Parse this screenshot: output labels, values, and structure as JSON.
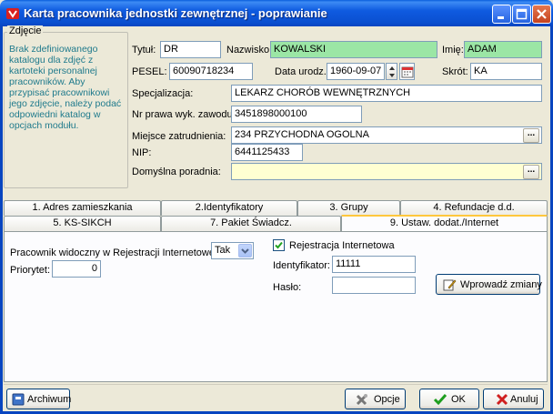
{
  "window": {
    "title": "Karta pracownika jednostki zewnętrznej - poprawianie",
    "colors": {
      "titlebar": "#0a4fd0",
      "field_green": "#9be6a5",
      "field_yellow": "#ffffd2",
      "photo_text": "#1f7a8c"
    }
  },
  "photo": {
    "legend": "Zdjęcie",
    "message": "Brak zdefiniowanego katalogu dla zdjęć z kartoteki personalnej pracowników. Aby przypisać pracownikowi jego zdjęcie, należy podać odpowiedni katalog w opcjach modułu."
  },
  "form": {
    "tytul": {
      "label": "Tytuł:",
      "value": "DR"
    },
    "nazwisko": {
      "label": "Nazwisko:",
      "value": "KOWALSKI"
    },
    "imie": {
      "label": "Imię:",
      "value": "ADAM"
    },
    "pesel": {
      "label": "PESEL:",
      "value": "60090718234"
    },
    "data_urodz": {
      "label": "Data urodz.:",
      "value": "1960-09-07"
    },
    "skrot": {
      "label": "Skrót:",
      "value": "KA"
    },
    "specjalizacja": {
      "label": "Specjalizacja:",
      "value": "LEKARZ CHORÓB WEWNĘTRZNYCH"
    },
    "nr_prawa": {
      "label": "Nr prawa wyk. zawodu:",
      "value": "3451898000100"
    },
    "miejsce": {
      "label": "Miejsce zatrudnienia:",
      "value": "234 PRZYCHODNA OGOLNA"
    },
    "nip": {
      "label": "NIP:",
      "value": "6441125433"
    },
    "poradnia": {
      "label": "Domyślna poradnia:",
      "value": ""
    },
    "dots": "..."
  },
  "tabs": {
    "row1": [
      "1. Adres zamieszkania",
      "2.Identyfikatory",
      "3. Grupy",
      "4. Refundacje d.d."
    ],
    "row2": [
      "5. KS-SIKCH",
      "7. Pakiet Świadcz.",
      "9. Ustaw. dodat./Internet"
    ],
    "active": "9. Ustaw. dodat./Internet"
  },
  "panel": {
    "widoczny_label": "Pracownik widoczny w Rejestracji Internetowej:",
    "widoczny_value": "Tak",
    "priorytet_label": "Priorytet:",
    "priorytet_value": "0",
    "rejestracja_label": "Rejestracja Internetowa",
    "rejestracja_checked": true,
    "identyfikator_label": "Identyfikator:",
    "identyfikator_value": "11111",
    "haslo_label": "Hasło:",
    "haslo_value": "",
    "wprowadz_label": "Wprowadź zmiany"
  },
  "footer": {
    "archiwum": "Archiwum",
    "opcje": "Opcje",
    "ok": "OK",
    "anuluj": "Anuluj"
  }
}
